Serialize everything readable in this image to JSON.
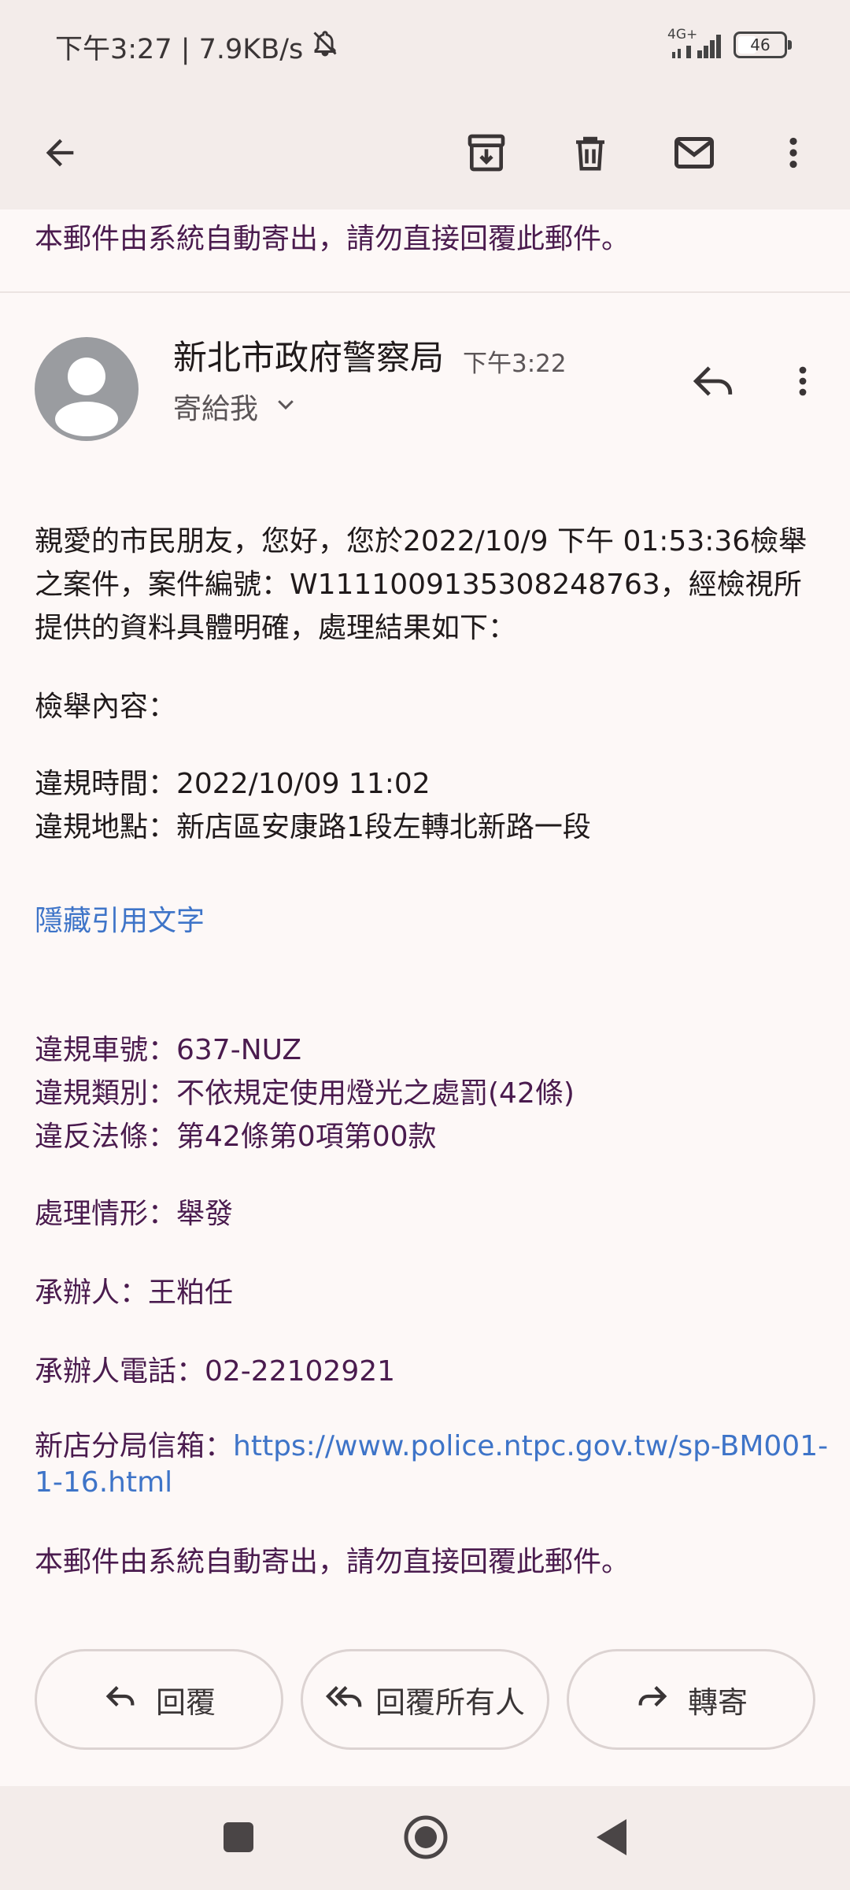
{
  "status_bar": {
    "time_speed": "下午3:27 | 7.9KB/s",
    "network": "4G+",
    "battery": "46",
    "battery_level": 0.46
  },
  "toolbar": {
    "icons": [
      "back-arrow-icon",
      "archive-icon",
      "delete-icon",
      "mark-unread-icon",
      "more-vert-icon"
    ]
  },
  "top_notice": "本郵件由系統自動寄出，請勿直接回覆此郵件。",
  "header": {
    "sender": "新北市政府警察局",
    "time": "下午3:22",
    "recipient": "寄給我"
  },
  "body": {
    "intro_1": "親愛的市民朋友，您好，您於2022/10/9 下午 01:53:36檢舉",
    "intro_2": "之案件，案件編號：W1111009135308248763，經檢視所",
    "intro_3": "提供的資料具體明確，處理結果如下：",
    "report_heading": "檢舉內容：",
    "violation_time": "違規時間：2022/10/09 11:02",
    "violation_place": "違規地點：新店區安康路1段左轉北新路一段",
    "hide_quoted": "隱藏引用文字",
    "plate": "違規車號：637-NUZ",
    "category": "違規類別：不依規定使用燈光之處罰(42條)",
    "law": "違反法條：第42條第0項第00款",
    "status": "處理情形：舉發",
    "officer": "承辦人：王粕任",
    "officer_phone": "承辦人電話：02-22102921",
    "mailbox_label": "新店分局信箱：",
    "mailbox_link_1": "https://www.police.ntpc.gov.tw/sp-BM001-",
    "mailbox_link_2": "1-16.html",
    "footer_notice": "本郵件由系統自動寄出，請勿直接回覆此郵件。"
  },
  "actions": {
    "reply": "回覆",
    "reply_all": "回覆所有人",
    "forward": "轉寄"
  },
  "colors": {
    "quoted_text": "#4a1b4e",
    "link": "#3e74c8",
    "avatar": "#9a9ca0"
  }
}
